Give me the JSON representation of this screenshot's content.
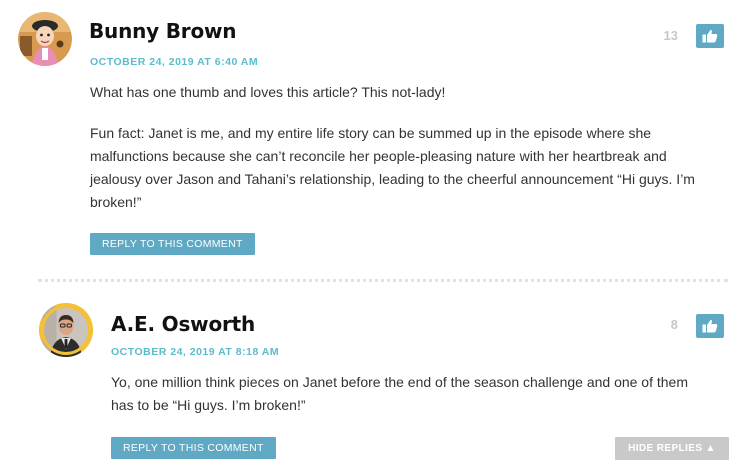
{
  "comments": [
    {
      "author": "Bunny Brown",
      "date": "OCTOBER 24, 2019 AT 6:40 AM",
      "likes": "13",
      "paragraphs": [
        "What has one thumb and loves this article? This not-lady!",
        "Fun fact: Janet is me, and my entire life story can be summed up in the episode where she malfunctions because she can’t reconcile her people-pleasing nature with her heartbreak and jealousy over Jason and Tahani’s relationship, leading to the cheerful announcement “Hi guys. I’m broken!”"
      ],
      "reply_label": "REPLY TO THIS COMMENT",
      "avatar_icon": "cartoon-girl-avatar"
    },
    {
      "author": "A.E. Osworth",
      "date": "OCTOBER 24, 2019 AT 8:18 AM",
      "likes": "8",
      "paragraphs": [
        "Yo, one million think pieces on Janet before the end of the season challenge and one of them has to be “Hi guys. I’m broken!”"
      ],
      "reply_label": "REPLY TO THIS COMMENT",
      "avatar_icon": "person-photo-avatar"
    }
  ],
  "hide_replies_label": "HIDE REPLIES ▲",
  "colors": {
    "accent": "#5fa9c4",
    "date": "#5bbccb",
    "avatar_ring": "#f3c037",
    "muted": "#c8c8c8"
  },
  "icons": {
    "like": "thumbs-up-icon"
  }
}
